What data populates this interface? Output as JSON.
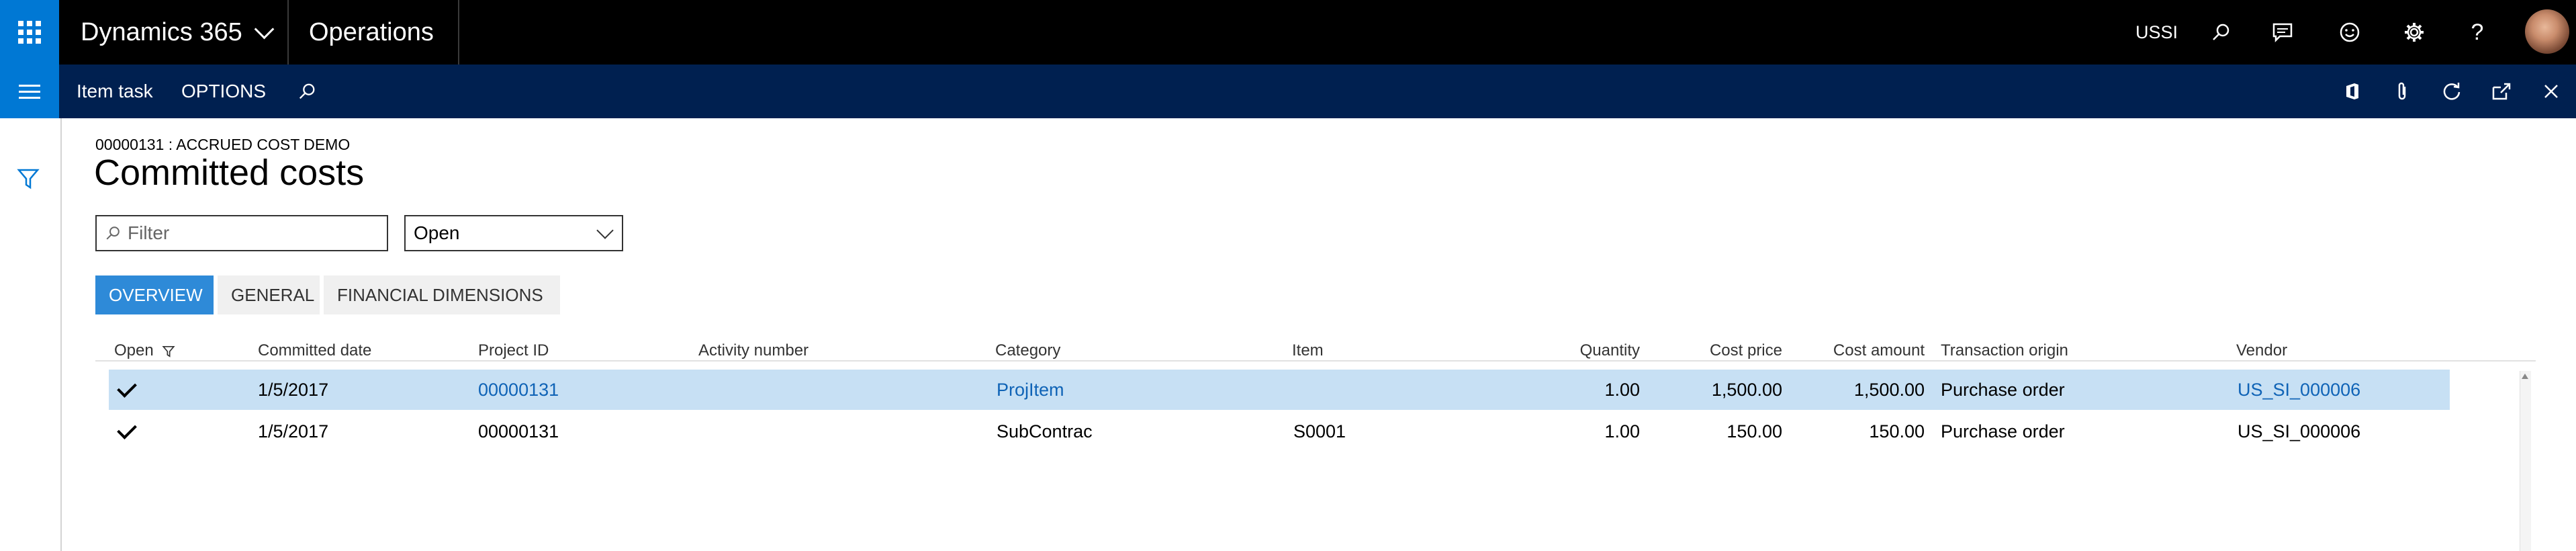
{
  "topbar": {
    "product": "Dynamics 365",
    "module": "Operations",
    "company": "USSI"
  },
  "actionbar": {
    "item_task": "Item task",
    "options": "OPTIONS"
  },
  "page": {
    "breadcrumb": "00000131 : ACCRUED COST DEMO",
    "title": "Committed costs"
  },
  "filter": {
    "placeholder": "Filter",
    "value": ""
  },
  "status_select": {
    "selected": "Open"
  },
  "tabs": [
    {
      "label": "OVERVIEW",
      "active": true
    },
    {
      "label": "GENERAL",
      "active": false
    },
    {
      "label": "FINANCIAL DIMENSIONS",
      "active": false
    }
  ],
  "grid": {
    "columns": {
      "open": "Open",
      "committed_date": "Committed date",
      "project_id": "Project ID",
      "activity_number": "Activity number",
      "category": "Category",
      "item": "Item",
      "quantity": "Quantity",
      "cost_price": "Cost price",
      "cost_amount": "Cost amount",
      "transaction_origin": "Transaction origin",
      "vendor": "Vendor"
    },
    "rows": [
      {
        "open": true,
        "committed_date": "1/5/2017",
        "project_id": "00000131",
        "activity_number": "",
        "category": "ProjItem",
        "item": "",
        "quantity": "1.00",
        "cost_price": "1,500.00",
        "cost_amount": "1,500.00",
        "transaction_origin": "Purchase order",
        "vendor": "US_SI_000006",
        "selected": true
      },
      {
        "open": true,
        "committed_date": "1/5/2017",
        "project_id": "00000131",
        "activity_number": "",
        "category": "SubContrac",
        "item": "S0001",
        "quantity": "1.00",
        "cost_price": "150.00",
        "cost_amount": "150.00",
        "transaction_origin": "Purchase order",
        "vendor": "US_SI_000006",
        "selected": false
      }
    ]
  },
  "colors": {
    "topbar": "#000000",
    "actionbar": "#002050",
    "accent": "#0078d4",
    "selected_row": "#c7e0f4",
    "link": "#0f63b6"
  }
}
